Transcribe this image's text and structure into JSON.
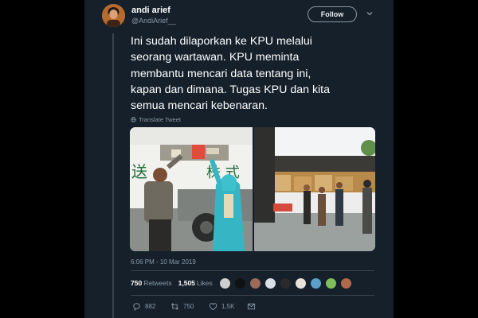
{
  "tweet": {
    "display_name": "andi arief",
    "handle": "@AndiArief__",
    "follow_label": "Follow",
    "text_lines": [
      "Ini sudah dilaporkan ke KPU melalui",
      "seorang wartawan. KPU meminta",
      "membantu mencari data tentang ini,",
      "kapan dan dimana. Tugas KPU dan kita",
      "semua mencari kebenaran."
    ],
    "translate_label": "Translate Tweet",
    "timestamp": "6:06 PM - 10 Mar 2019"
  },
  "stats": {
    "retweets_count": "750",
    "retweets_label": "Retweets",
    "likes_count": "1,505",
    "likes_label": "Likes"
  },
  "actions": {
    "reply_count": "882",
    "retweet_count": "750",
    "like_count": "1,5K"
  },
  "media": {
    "truck_lettering_left": "送",
    "truck_lettering_right": "株 式"
  },
  "colors": {
    "background": "#000000",
    "card": "#15202b",
    "secondary_text": "#8899a6",
    "divider": "#38444d"
  },
  "icons": [
    "chevron-down-icon",
    "globe-icon",
    "reply-icon",
    "retweet-icon",
    "like-icon",
    "message-icon"
  ]
}
